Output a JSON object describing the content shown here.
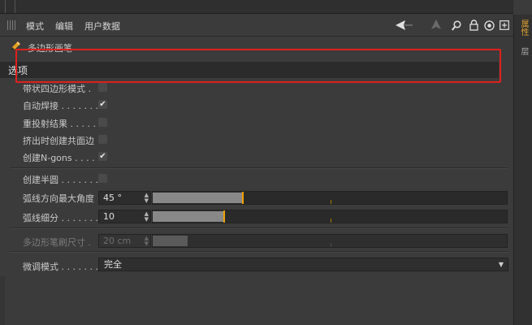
{
  "menu": {
    "items": [
      "模式",
      "编辑",
      "用户数据"
    ]
  },
  "header": {
    "title": "多边形画笔"
  },
  "tabs": [
    {
      "label": "选项"
    }
  ],
  "sidebar_tabs": [
    "属性",
    "层"
  ],
  "options": {
    "c1": {
      "label": "带状四边形模式 .",
      "checked": false
    },
    "c2": {
      "label": "自动焊接 . . . . . . .",
      "checked": true
    },
    "c3": {
      "label": "重投射结果 . . . . .",
      "checked": false
    },
    "c4": {
      "label": "挤出时创建共面边",
      "checked": false
    },
    "c5": {
      "label": "创建N-gons . . . .",
      "checked": true
    }
  },
  "arc": {
    "half_circle": {
      "label": "创建半圆 . . . . . . .",
      "checked": false
    },
    "max_angle": {
      "label": "弧线方向最大角度",
      "value": "45 °",
      "slider_fraction": 0.25
    },
    "subdiv": {
      "label": "弧线细分 . . . . . . .",
      "value": "10",
      "slider_fraction": 0.2
    }
  },
  "brush": {
    "label": "多边形笔刷尺寸 .",
    "value": "20 cm",
    "slider_fraction": 0.1
  },
  "tweak": {
    "label": "微调模式 . . . . . . .",
    "value": "完全"
  },
  "icons": {
    "checkmark": "✔",
    "spin": "▲▼",
    "dropdown": "▼",
    "tools": [
      "left-arrow-icon",
      "up-arrow-icon",
      "search-icon",
      "lock-icon",
      "target-icon",
      "new-window-icon"
    ]
  },
  "colors": {
    "accent": "#f0a000",
    "highlight_box": "#e0201c"
  }
}
